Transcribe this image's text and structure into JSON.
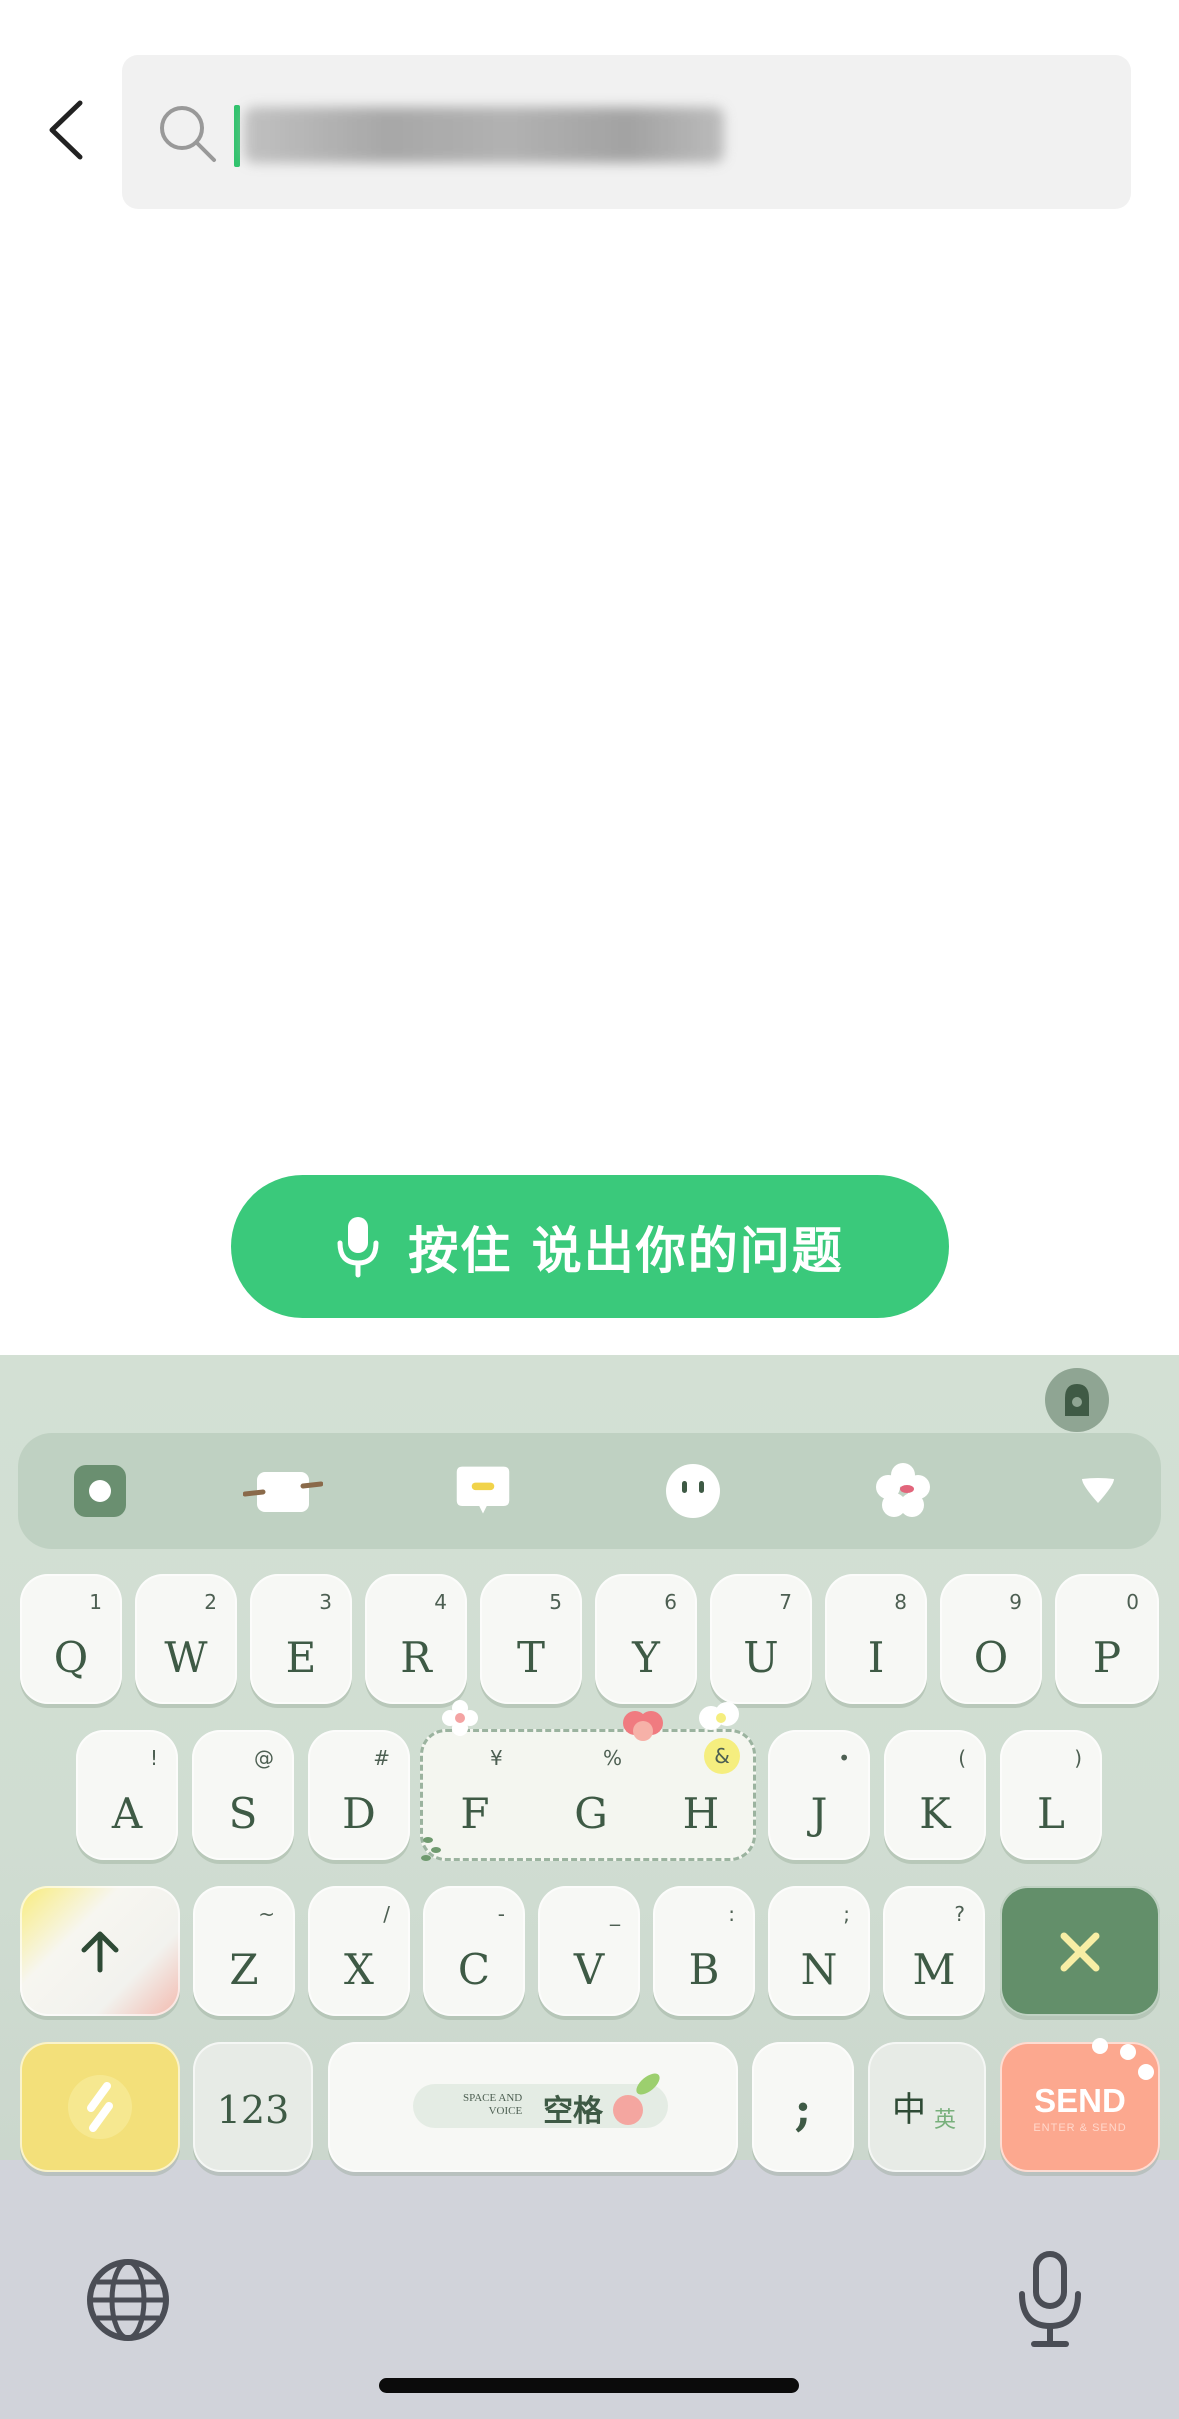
{
  "search": {
    "back_icon": "chevron-left-icon",
    "search_icon": "magnifier-icon",
    "query_text": ""
  },
  "voice_button": {
    "label": "按住 说出你的问题",
    "icon": "microphone-icon",
    "color": "#3ac97b"
  },
  "keyboard": {
    "toolbar_icons": [
      "keyboard-theme-icon",
      "cursor-move-icon",
      "clipboard-icon",
      "emoji-icon",
      "sticker-flower-icon",
      "collapse-icon"
    ],
    "row1": [
      {
        "key": "Q",
        "sub": "1"
      },
      {
        "key": "W",
        "sub": "2"
      },
      {
        "key": "E",
        "sub": "3"
      },
      {
        "key": "R",
        "sub": "4"
      },
      {
        "key": "T",
        "sub": "5"
      },
      {
        "key": "Y",
        "sub": "6"
      },
      {
        "key": "U",
        "sub": "7"
      },
      {
        "key": "I",
        "sub": "8"
      },
      {
        "key": "O",
        "sub": "9"
      },
      {
        "key": "P",
        "sub": "0"
      }
    ],
    "row2": [
      {
        "key": "A",
        "sub": "!"
      },
      {
        "key": "S",
        "sub": "@"
      },
      {
        "key": "D",
        "sub": "#"
      },
      {
        "key": "F",
        "sub": "¥"
      },
      {
        "key": "G",
        "sub": "%"
      },
      {
        "key": "H",
        "sub": "&"
      },
      {
        "key": "J",
        "sub": "•"
      },
      {
        "key": "K",
        "sub": "("
      },
      {
        "key": "L",
        "sub": ")"
      }
    ],
    "row3": [
      {
        "key": "Z",
        "sub": "~"
      },
      {
        "key": "X",
        "sub": "/"
      },
      {
        "key": "C",
        "sub": "-"
      },
      {
        "key": "V",
        "sub": "_"
      },
      {
        "key": "B",
        "sub": ":"
      },
      {
        "key": "N",
        "sub": ";"
      },
      {
        "key": "M",
        "sub": "?"
      }
    ],
    "numbers_key": "123",
    "space": {
      "en_line1": "SPACE AND",
      "en_line2": "VOICE",
      "cn": "空格"
    },
    "punct_key": ";",
    "lang_key_main": "中",
    "lang_key_sub": "英",
    "send_key": {
      "label": "SEND",
      "sub": "ENTER & SEND"
    },
    "accent_colors": {
      "dark_green": "#638f6a",
      "yellow": "#f3e07a",
      "peach": "#fca88f"
    }
  },
  "system": {
    "globe_icon": "globe-icon",
    "dictation_icon": "microphone-icon"
  }
}
